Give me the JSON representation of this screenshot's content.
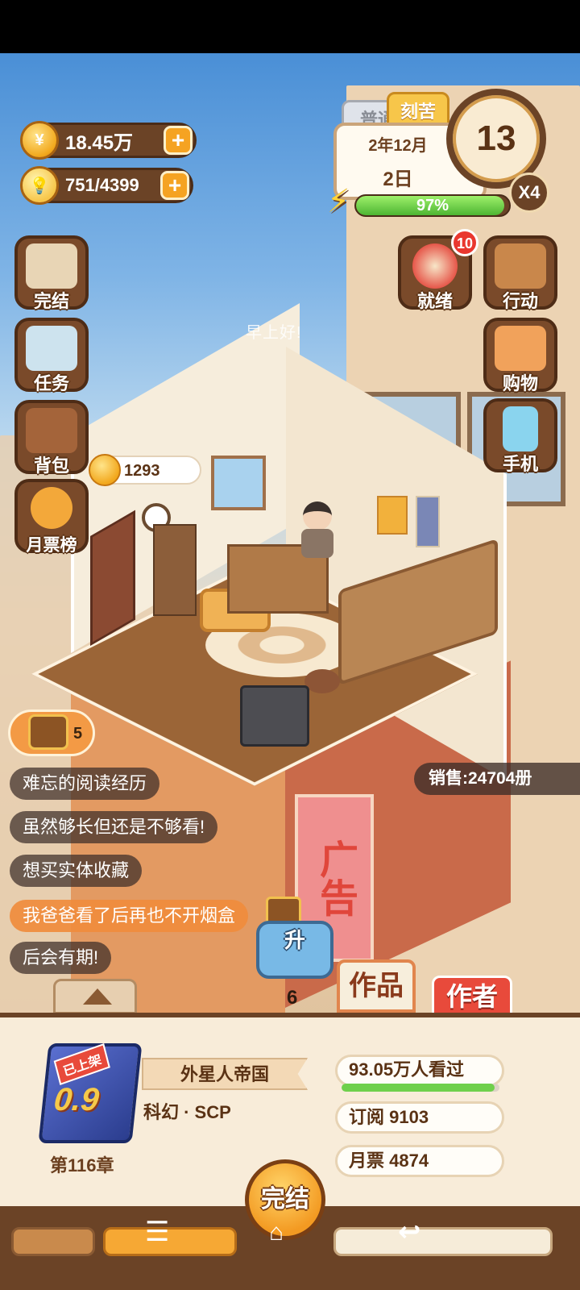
{
  "currency": {
    "coins": "18.45万",
    "energy": "751/4399"
  },
  "mode_tabs": {
    "normal": "普通",
    "hard": "刻苦"
  },
  "date": {
    "month": "2年12月",
    "day": "2日"
  },
  "clock": {
    "value": "13",
    "speed": "X4"
  },
  "stamina": {
    "percent_text": "97%",
    "percent": 97
  },
  "left_menu": {
    "finish": "完结",
    "tasks": "任务",
    "bag": "背包",
    "monthly_rank": "月票榜"
  },
  "right_menu": {
    "ready": "就绪",
    "ready_badge": "10",
    "action": "行动",
    "shop": "购物",
    "phone": "手机"
  },
  "greeting": "早上好!",
  "room_coin": "1293",
  "chest_count": "5",
  "comments": [
    "难忘的阅读经历",
    "虽然够长但还是不够看!",
    "想买实体收藏",
    "我爸爸看了后再也不开烟盒",
    "后会有期!"
  ],
  "sales": "销售:24704册",
  "ad_sign": "广告",
  "upgrade": {
    "label": "升",
    "count": "6"
  },
  "tabs": {
    "works": "作品",
    "author": "作者"
  },
  "book": {
    "tag": "已上架",
    "rating": "0.9",
    "chapter": "第116章",
    "title": "外星人帝国",
    "genre": "科幻 · SCP",
    "views": "93.05万人看过",
    "views_progress": 0.97,
    "subscriptions": "订阅 9103",
    "monthly_votes": "月票 4874"
  },
  "finish_button": "完结",
  "colors": {
    "accent": "#f39a22",
    "brand_brown": "#6b4326",
    "energy_green": "#4db533",
    "author_red": "#e84a3b"
  },
  "nav_icons": [
    "menu-icon",
    "home-icon",
    "back-icon"
  ]
}
